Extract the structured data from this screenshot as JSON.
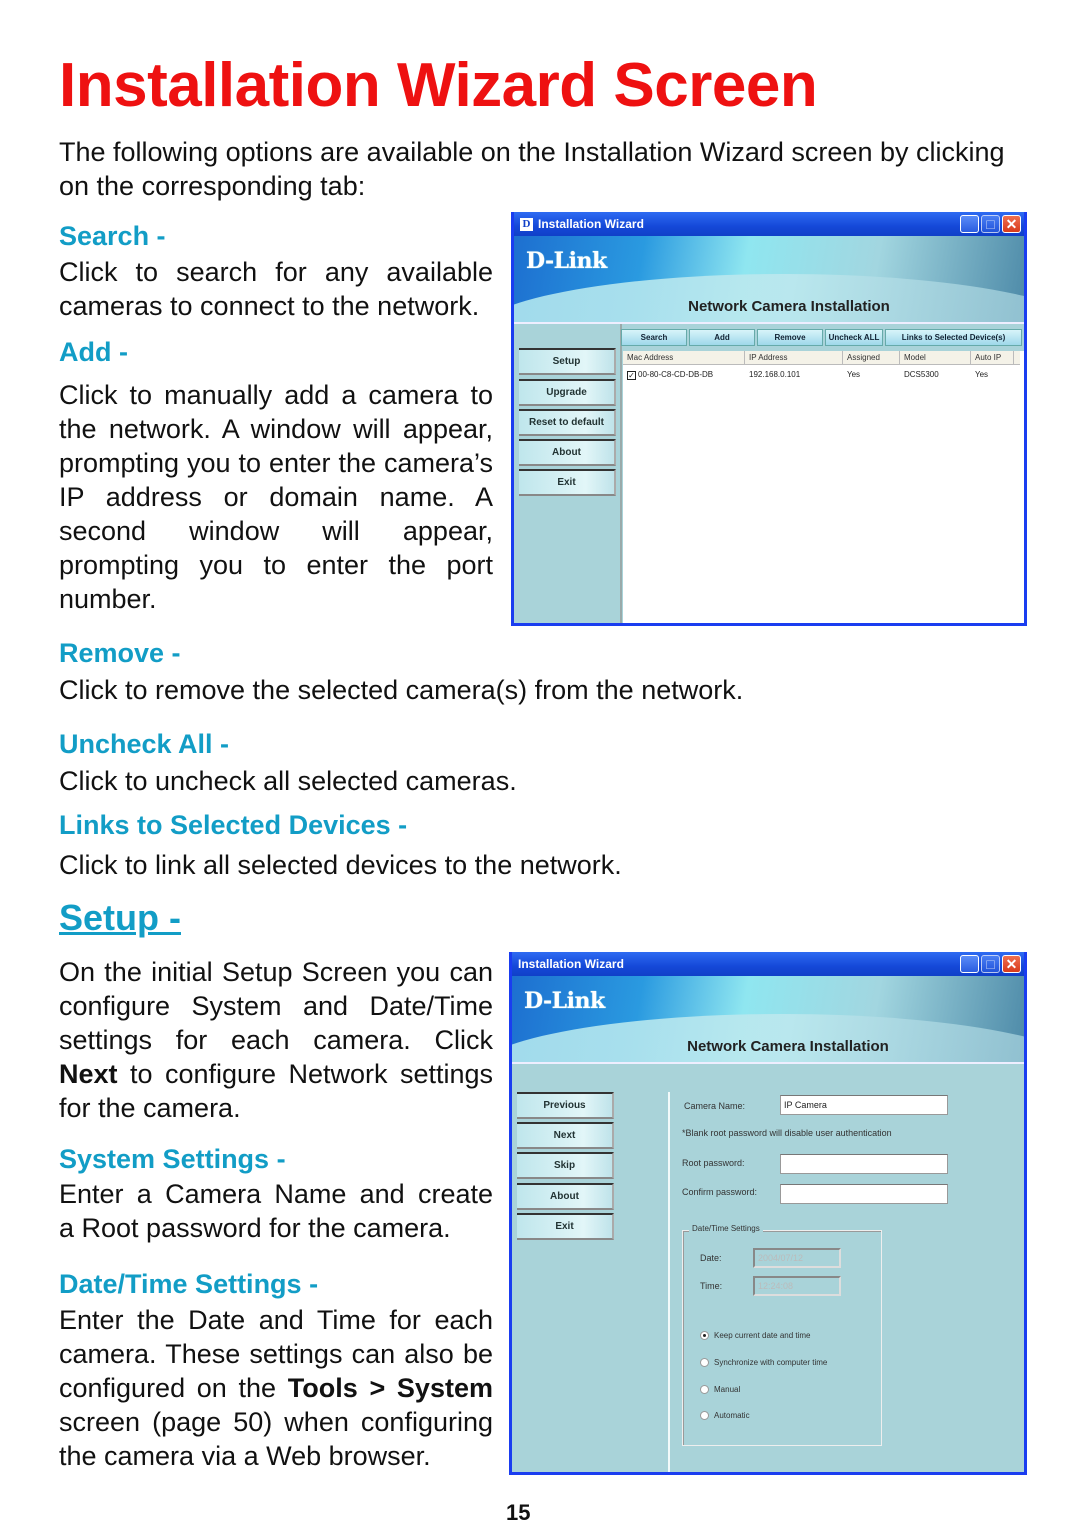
{
  "page": {
    "title": "Installation Wizard Screen",
    "intro": "The following options are available on the Installation Wizard screen by clicking on the corresponding tab:",
    "page_number": "15"
  },
  "sections": {
    "search": {
      "heading": "Search -",
      "lines": [
        "Click to search for any available",
        "cameras to connect to the network."
      ]
    },
    "add": {
      "heading": "Add -",
      "lines": [
        "Click to manually add a camera to",
        "the network. A window will appear,",
        "prompting you to enter the camera’s",
        "IP address or domain name. A",
        "second window will appear,",
        "prompting you to enter the port",
        "number."
      ]
    },
    "remove": {
      "heading": "Remove -",
      "text": "Click to remove the selected camera(s) from the network."
    },
    "uncheck_all": {
      "heading": "Uncheck All -",
      "text": "Click to uncheck all selected cameras."
    },
    "links": {
      "heading": "Links to Selected Devices -",
      "text": "Click to link all selected devices to the network."
    },
    "setup": {
      "heading": "Setup -",
      "lines": [
        "On the initial Setup Screen you can",
        "configure System and Date/Time",
        "settings for each camera. Click"
      ],
      "line4_bold": "Next",
      "line4_rest": " to configure Network settings",
      "line5": "for the camera."
    },
    "system_settings": {
      "heading": "System Settings -",
      "lines": [
        "Enter a Camera Name and create",
        "a Root password for the camera."
      ]
    },
    "datetime_settings": {
      "heading": "Date/Time Settings -",
      "lines": [
        "Enter the Date and Time for each",
        "camera. These settings can also be"
      ],
      "line3_pre": "configured on the ",
      "line3_bold": "Tools > System",
      "lines_after": [
        "screen (page 50) when configuring",
        "the camera via a Web browser."
      ]
    }
  },
  "window1": {
    "title": "Installation Wizard",
    "title_icon": "D",
    "brand": "D-Link",
    "subtitle": "Network Camera Installation",
    "tabs": [
      "Search",
      "Add",
      "Remove",
      "Uncheck ALL",
      "Links to Selected Device(s)"
    ],
    "sidebar": [
      "Setup",
      "Upgrade",
      "Reset to default",
      "About",
      "Exit"
    ],
    "columns": [
      "Mac Address",
      "IP Address",
      "Assigned",
      "Model",
      "Auto IP"
    ],
    "rows": [
      {
        "checked": true,
        "mac": "00-80-C8-CD-DB-DB",
        "ip": "192.168.0.101",
        "assigned": "Yes",
        "model": "DCS5300",
        "auto_ip": "Yes"
      }
    ],
    "controls": {
      "minimize": "_",
      "maximize": "□",
      "close": "✕"
    }
  },
  "window2": {
    "title": "Installation Wizard",
    "brand": "D-Link",
    "subtitle": "Network Camera Installation",
    "sidebar": [
      "Previous",
      "Next",
      "Skip",
      "About",
      "Exit"
    ],
    "camera_name_label": "Camera Name:",
    "camera_name_value": "IP Camera",
    "password_note": "*Blank root password will disable user authentication",
    "root_password_label": "Root password:",
    "confirm_password_label": "Confirm password:",
    "datetime_group": "Date/Time Settings",
    "date_label": "Date:",
    "date_value": "2004/07/12",
    "time_label": "Time:",
    "time_value": "12:24:08",
    "radio_options": [
      {
        "label": "Keep current date and time",
        "selected": true
      },
      {
        "label": "Synchronize with computer time",
        "selected": false
      },
      {
        "label": "Manual",
        "selected": false
      },
      {
        "label": "Automatic",
        "selected": false
      }
    ],
    "controls": {
      "minimize": "_",
      "maximize": "□",
      "close": "✕"
    }
  }
}
